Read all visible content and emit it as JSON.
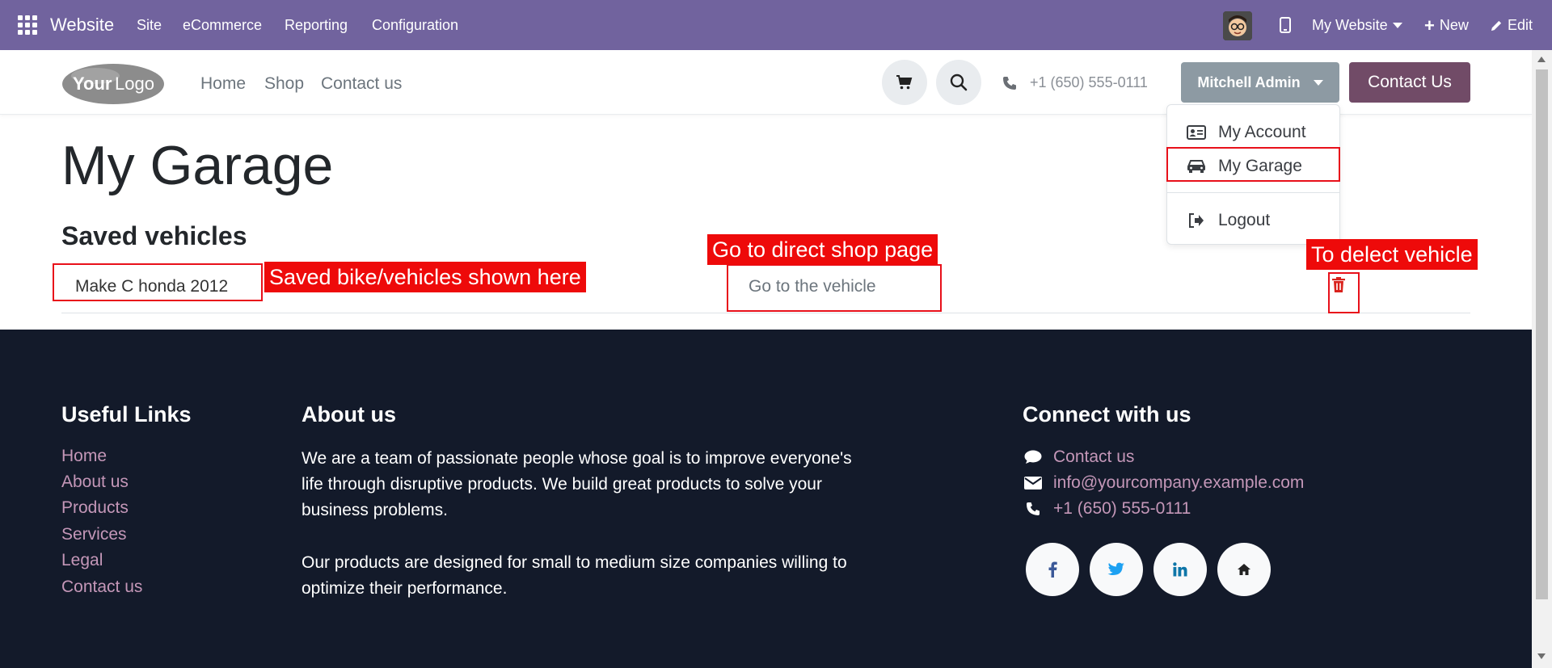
{
  "admin_bar": {
    "brand": "Website",
    "menu": [
      "Site",
      "eCommerce",
      "Reporting",
      "Configuration"
    ],
    "website_selector": "My Website",
    "new_label": "New",
    "edit_label": "Edit",
    "background": "#71639e"
  },
  "header": {
    "logo_text": "YourLogo",
    "nav": [
      "Home",
      "Shop",
      "Contact us"
    ],
    "phone": "+1 (650) 555-0111",
    "user_button": "Mitchell Admin",
    "contact_button": "Contact Us"
  },
  "user_dropdown": {
    "items": [
      {
        "label": "My Account",
        "icon": "id-card-icon"
      },
      {
        "label": "My Garage",
        "icon": "car-icon"
      },
      {
        "label": "Logout",
        "icon": "sign-out-icon"
      }
    ]
  },
  "main": {
    "title": "My Garage",
    "section_title": "Saved vehicles",
    "vehicles": [
      {
        "name": "Make C honda 2012",
        "link_label": "Go to the vehicle",
        "delete_icon": "trash-icon"
      }
    ]
  },
  "annotations": {
    "vehicles_label": "Saved bike/vehicles shown here",
    "shop_page_label": "Go to direct shop page",
    "delete_label": "To delect vehicle",
    "color": "#ee0a0a"
  },
  "footer": {
    "useful_links_title": "Useful Links",
    "useful_links": [
      "Home",
      "About us",
      "Products",
      "Services",
      "Legal",
      "Contact us"
    ],
    "about_title": "About us",
    "about_paragraphs": [
      [
        "We are a team of passionate people whose goal is to improve everyone's",
        "life through disruptive products. We build great products to solve your",
        "business problems."
      ],
      [
        "Our products are designed for small to medium size companies willing to",
        "optimize their performance."
      ]
    ],
    "connect_title": "Connect with us",
    "contacts": [
      {
        "label": "Contact us",
        "icon": "comment-icon"
      },
      {
        "label": "info@yourcompany.example.com",
        "icon": "envelope-icon"
      },
      {
        "label": "+1 (650) 555-0111",
        "icon": "phone-icon"
      }
    ],
    "social": [
      "facebook-icon",
      "twitter-icon",
      "linkedin-icon",
      "home-icon"
    ],
    "background": "#131a2a",
    "link_color": "#c497b8"
  },
  "colors": {
    "primary": "#714b67",
    "admin_button": "#8d9aa3"
  }
}
